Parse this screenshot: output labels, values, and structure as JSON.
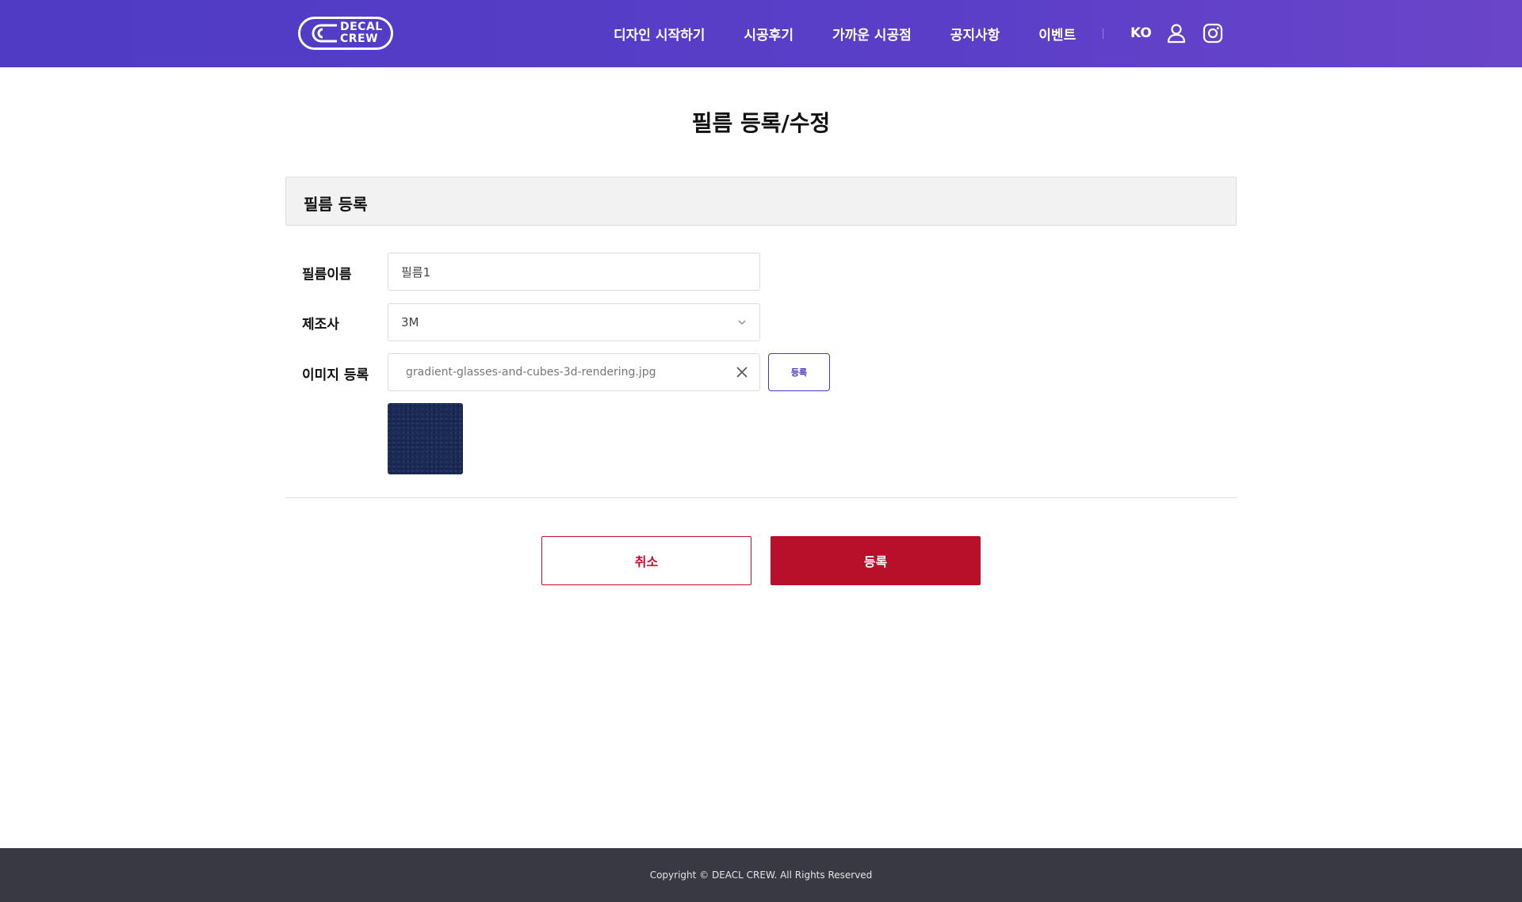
{
  "header": {
    "logo": {
      "line1": "DECAL",
      "line2": "CREW"
    },
    "nav": [
      "디자인 시작하기",
      "시공후기",
      "가까운 시공점",
      "공지사항",
      "이벤트"
    ],
    "lang": "KO",
    "icons": {
      "user": "user-icon",
      "instagram": "instagram-icon"
    }
  },
  "page": {
    "title": "필름 등록/수정"
  },
  "section": {
    "title": "필름 등록"
  },
  "form": {
    "name_label": "필름이름",
    "name_value": "필름1",
    "maker_label": "제조사",
    "maker_value": "3M",
    "image_label": "이미지 등록",
    "image_file": "gradient-glasses-and-cubes-3d-rendering.jpg",
    "upload_label": "등록"
  },
  "actions": {
    "cancel": "취소",
    "submit": "등록"
  },
  "footer": {
    "copyright": "Copyright © DEACL CREW. All Rights Reserved"
  },
  "colors": {
    "header": "#5a3ec8",
    "accent": "#4a38c0",
    "submit": "#b8102a",
    "footer": "#383942"
  }
}
